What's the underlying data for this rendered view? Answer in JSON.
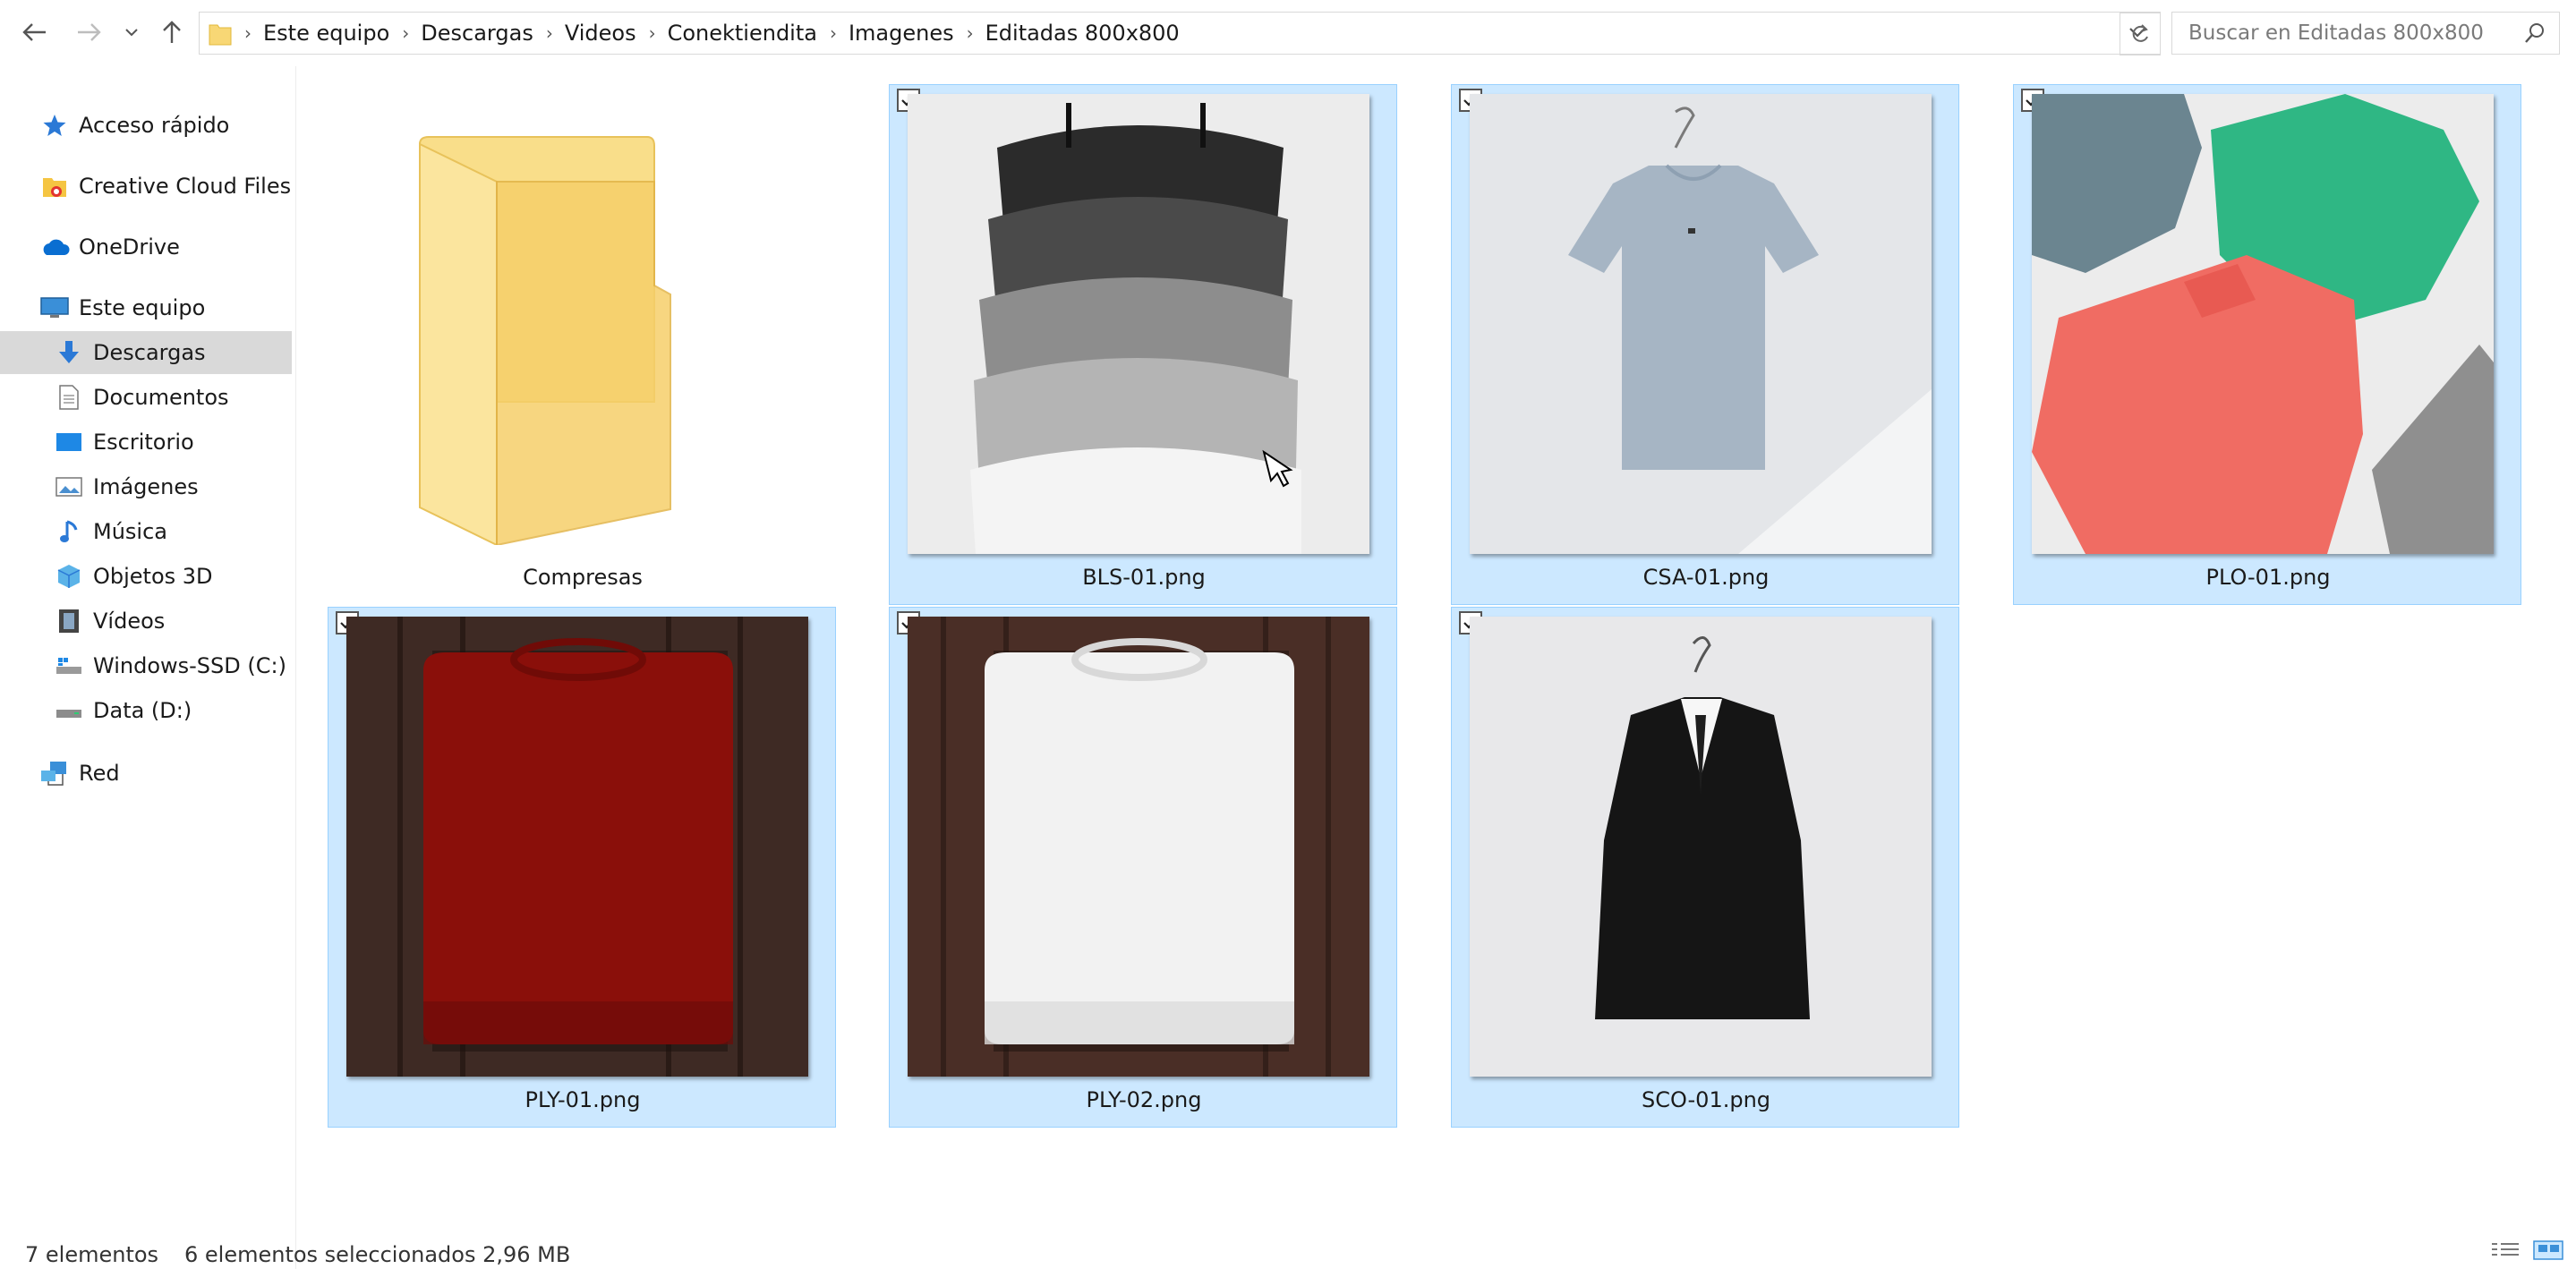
{
  "breadcrumb": [
    "Este equipo",
    "Descargas",
    "Videos",
    "Conektiendita",
    "Imagenes",
    "Editadas 800x800"
  ],
  "search": {
    "placeholder": "Buscar en Editadas 800x800"
  },
  "sidebar": {
    "items": [
      {
        "label": "Acceso rápido",
        "icon": "star-icon"
      },
      {
        "label": "Creative Cloud Files",
        "icon": "creative-cloud-folder-icon"
      },
      {
        "label": "OneDrive",
        "icon": "cloud-icon"
      },
      {
        "label": "Este equipo",
        "icon": "computer-icon"
      },
      {
        "label": "Descargas",
        "icon": "download-arrow-icon",
        "selected": true
      },
      {
        "label": "Documentos",
        "icon": "document-icon"
      },
      {
        "label": "Escritorio",
        "icon": "desktop-icon"
      },
      {
        "label": "Imágenes",
        "icon": "pictures-icon"
      },
      {
        "label": "Música",
        "icon": "music-note-icon"
      },
      {
        "label": "Objetos 3D",
        "icon": "cube-icon"
      },
      {
        "label": "Vídeos",
        "icon": "film-icon"
      },
      {
        "label": "Windows-SSD (C:)",
        "icon": "system-drive-icon"
      },
      {
        "label": "Data (D:)",
        "icon": "drive-icon"
      },
      {
        "label": "Red",
        "icon": "network-icon"
      }
    ]
  },
  "files": [
    {
      "name": "Compresas",
      "type": "folder",
      "selected": false
    },
    {
      "name": "BLS-01.png",
      "type": "image",
      "selected": true,
      "checked": true
    },
    {
      "name": "CSA-01.png",
      "type": "image",
      "selected": true,
      "checked": true
    },
    {
      "name": "PLO-01.png",
      "type": "image",
      "selected": true,
      "checked": true
    },
    {
      "name": "PLY-01.png",
      "type": "image",
      "selected": true,
      "checked": true
    },
    {
      "name": "PLY-02.png",
      "type": "image",
      "selected": true,
      "checked": true
    },
    {
      "name": "SCO-01.png",
      "type": "image",
      "selected": true,
      "checked": true
    }
  ],
  "status": {
    "count": "7 elementos",
    "selection": "6 elementos seleccionados  2,96 MB"
  },
  "colors": {
    "selection_bg": "#cce8ff",
    "selection_border": "#99d1ff",
    "sidebar_selected": "#d9d9d9"
  }
}
